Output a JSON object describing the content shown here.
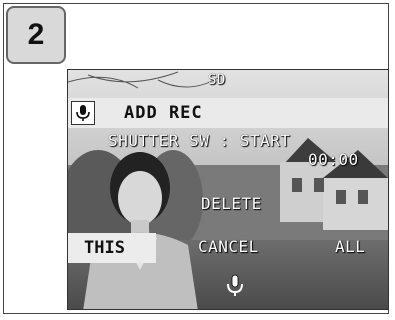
{
  "step": {
    "number": "2"
  },
  "screen": {
    "media_label": "SD",
    "title": "ADD REC",
    "title_icon": "microphone-icon",
    "instruction": "SHUTTER SW : START",
    "timer": "00:00",
    "options": {
      "delete": "DELETE",
      "this": "THIS",
      "cancel": "CANCEL",
      "all": "ALL"
    },
    "status_icon": "microphone-icon"
  }
}
